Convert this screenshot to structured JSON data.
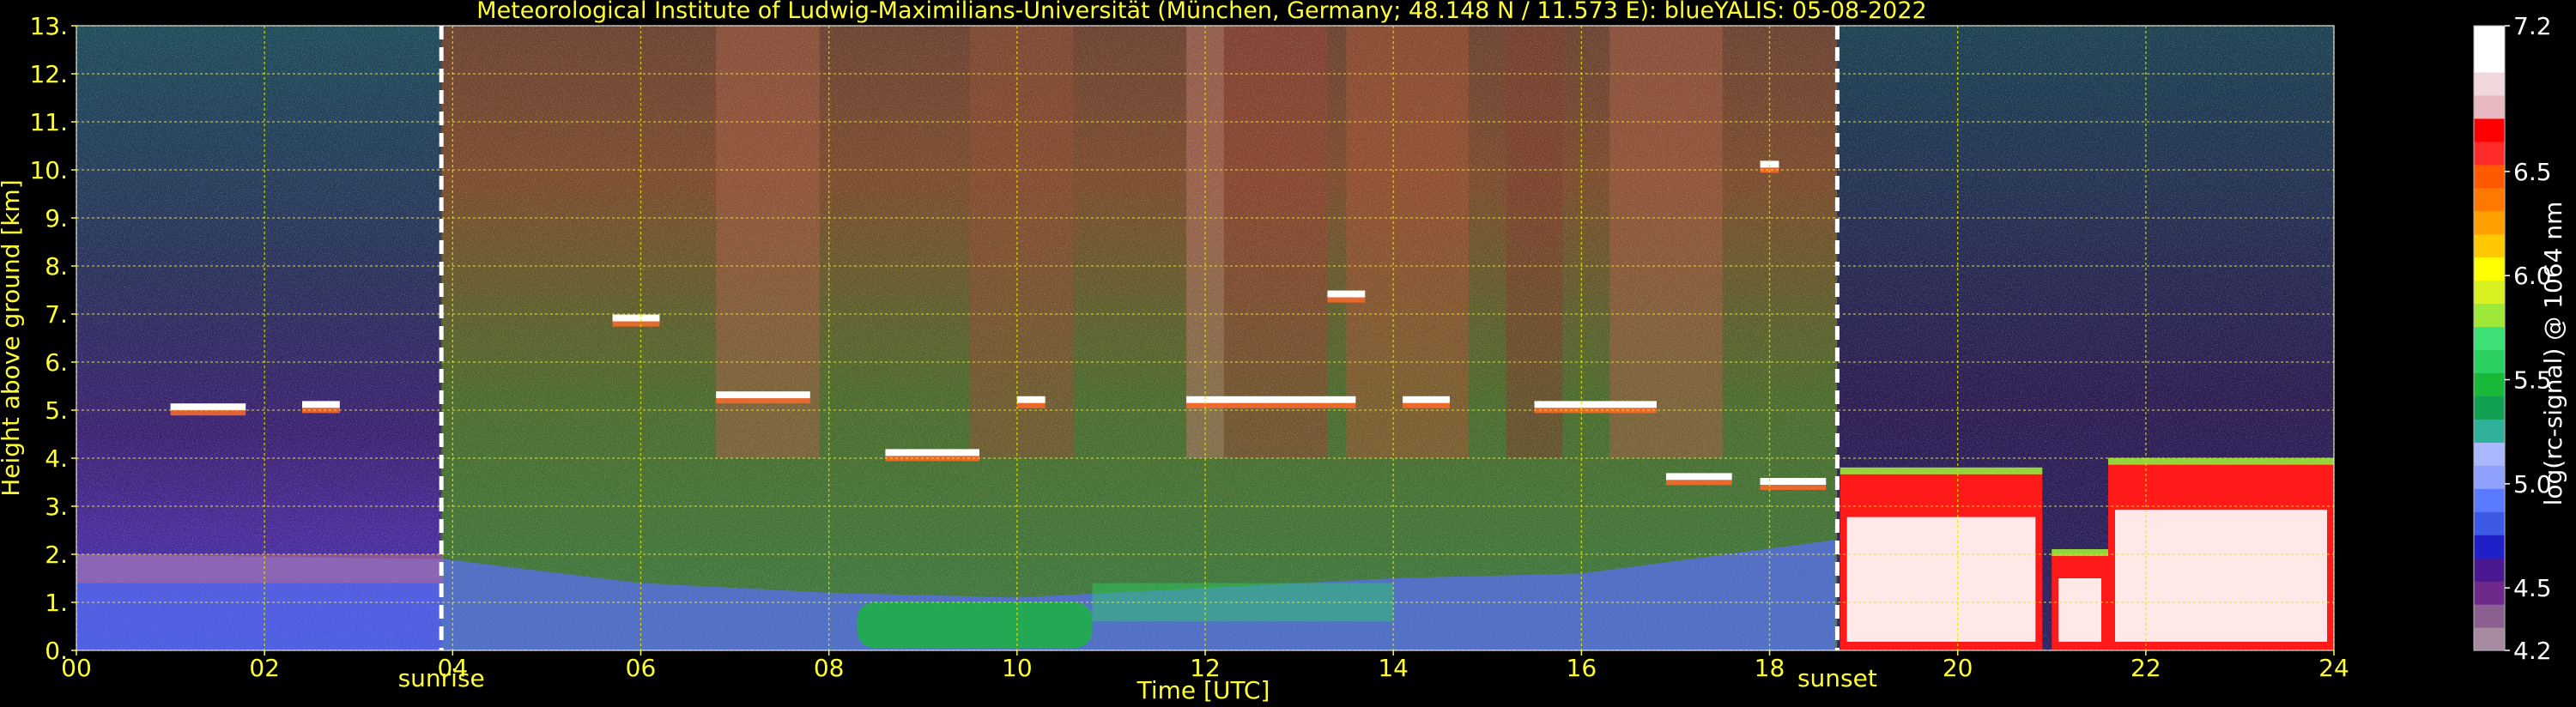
{
  "chart_data": {
    "type": "heatmap",
    "title": "Meteorological Institute of Ludwig-Maximilians-Universität (München, Germany; 48.148 N / 11.573 E):    blueYALIS: 05-08-2022",
    "xlabel": "Time [UTC]",
    "ylabel": "Height above ground [km]",
    "xlim": [
      0,
      24
    ],
    "ylim": [
      0,
      13
    ],
    "x_ticks": [
      "00",
      "02",
      "04",
      "06",
      "08",
      "10",
      "12",
      "14",
      "16",
      "18",
      "20",
      "22",
      "24"
    ],
    "y_ticks": [
      "0.",
      "1.",
      "2.",
      "3.",
      "4.",
      "5.",
      "6.",
      "7.",
      "8.",
      "9.",
      "10.",
      "11.",
      "12.",
      "13."
    ],
    "grid": true,
    "markers": [
      {
        "label": "sunrise",
        "x": 3.88
      },
      {
        "label": "sunset",
        "x": 18.72
      }
    ],
    "colorbar": {
      "label": "log(rc-signal) @ 1064 nm",
      "ticks": [
        "4.2",
        "4.5",
        "5.0",
        "5.5",
        "6.0",
        "6.5",
        "7.2"
      ],
      "tick_values": [
        4.2,
        4.5,
        5.0,
        5.5,
        6.0,
        6.5,
        7.2
      ],
      "range": [
        4.2,
        7.2
      ],
      "colors": [
        "#a58aa0",
        "#8c5f91",
        "#6e2a8a",
        "#4a1890",
        "#2020c8",
        "#3c5ae6",
        "#5a7aff",
        "#8fa0ff",
        "#aab8ff",
        "#30b09a",
        "#12a052",
        "#18b838",
        "#2ad060",
        "#3ce074",
        "#9ee83a",
        "#d8f020",
        "#ffff00",
        "#ffc800",
        "#ffa000",
        "#ff7800",
        "#ff5a00",
        "#ff2a2a",
        "#ff0000",
        "#e8b8c0",
        "#f0d8dc",
        "#ffffff",
        "#ffffff"
      ]
    },
    "cloud_layers": [
      {
        "t_start": 1.0,
        "t_end": 1.8,
        "height": 5.05
      },
      {
        "t_start": 2.4,
        "t_end": 2.8,
        "height": 5.1
      },
      {
        "t_start": 5.7,
        "t_end": 6.2,
        "height": 6.9
      },
      {
        "t_start": 6.8,
        "t_end": 7.8,
        "height": 5.3
      },
      {
        "t_start": 8.6,
        "t_end": 9.6,
        "height": 4.1
      },
      {
        "t_start": 10.0,
        "t_end": 10.3,
        "height": 5.2
      },
      {
        "t_start": 11.8,
        "t_end": 13.6,
        "height": 5.2
      },
      {
        "t_start": 13.3,
        "t_end": 13.7,
        "height": 7.4
      },
      {
        "t_start": 14.1,
        "t_end": 14.6,
        "height": 5.2
      },
      {
        "t_start": 15.5,
        "t_end": 16.8,
        "height": 5.1
      },
      {
        "t_start": 16.9,
        "t_end": 17.6,
        "height": 3.6
      },
      {
        "t_start": 17.9,
        "t_end": 18.6,
        "height": 3.5
      },
      {
        "t_start": 17.9,
        "t_end": 18.1,
        "height": 10.1
      }
    ],
    "boundary_layer": [
      {
        "t": 0,
        "top": 2.0
      },
      {
        "t": 3.9,
        "top": 1.9
      },
      {
        "t": 6,
        "top": 1.4
      },
      {
        "t": 8,
        "top": 1.2
      },
      {
        "t": 10,
        "top": 1.1
      },
      {
        "t": 12,
        "top": 1.3
      },
      {
        "t": 14,
        "top": 1.5
      },
      {
        "t": 16,
        "top": 1.6
      },
      {
        "t": 18.7,
        "top": 2.3
      }
    ],
    "evening_clouds": [
      {
        "t_start": 18.75,
        "t_end": 20.9,
        "top": 3.7
      },
      {
        "t_start": 21.0,
        "t_end": 21.6,
        "top": 2.0
      },
      {
        "t_start": 21.6,
        "t_end": 24.0,
        "top": 3.9
      }
    ]
  }
}
